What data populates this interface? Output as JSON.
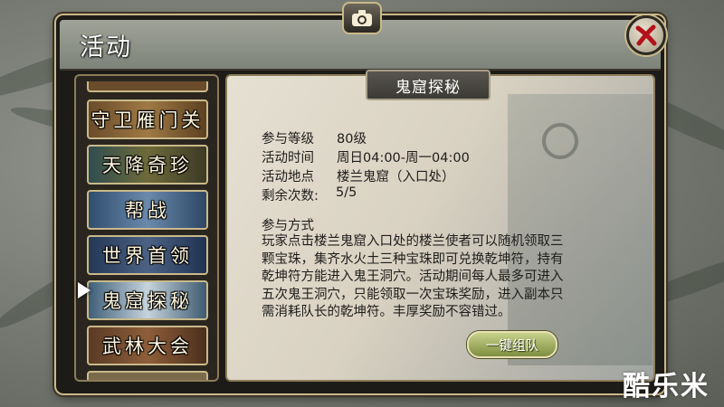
{
  "window": {
    "title": "活动"
  },
  "icons": {
    "camera": "camera-icon",
    "close": "close-icon",
    "selected": "arrow-right-icon"
  },
  "tabs": [
    {
      "label": "守卫雁门关"
    },
    {
      "label": "天降奇珍"
    },
    {
      "label": "帮战"
    },
    {
      "label": "世界首领"
    },
    {
      "label": "鬼窟探秘",
      "selected": true
    },
    {
      "label": "武林大会"
    }
  ],
  "detail": {
    "header": "鬼窟探秘",
    "info": [
      {
        "label": "参与等级",
        "value": "80级"
      },
      {
        "label": "活动时间",
        "value": "周日04:00-周一04:00"
      },
      {
        "label": "活动地点",
        "value": "楼兰鬼窟（入口处）"
      },
      {
        "label": "剩余次数:",
        "value": "5/5"
      }
    ],
    "method_title": "参与方式",
    "method_lines": [
      "玩家点击楼兰鬼窟入口处的楼兰使者可以随机领取三",
      "颗宝珠，集齐水火土三种宝珠即可兑换乾坤符，持有",
      "乾坤符方能进入鬼王洞穴。活动期间每人最多可进入",
      "五次鬼王洞穴，只能领取一次宝珠奖励，进入副本只",
      "需消耗队长的乾坤符。丰厚奖励不容错过。"
    ],
    "team_button": "一键组队"
  },
  "watermark": "酷乐米",
  "colors": {
    "frame_gold": "#c9b98a",
    "button_green": "#7e8e3f",
    "panel_bg": "#e6e0d3"
  }
}
